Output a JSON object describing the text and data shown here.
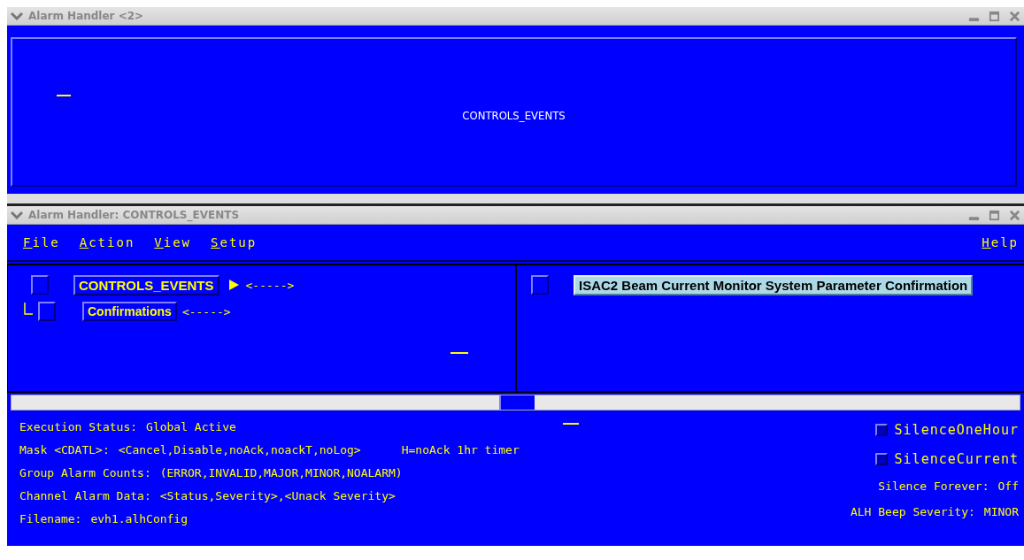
{
  "windows": [
    {
      "title": "Alarm Handler <2>",
      "kind": "icon",
      "label": "CONTROLS_EVENTS"
    },
    {
      "title": "Alarm Handler: CONTROLS_EVENTS",
      "kind": "main"
    }
  ],
  "menu": {
    "left": [
      "File",
      "Action",
      "View",
      "Setup"
    ],
    "right": [
      "Help"
    ]
  },
  "tree": [
    {
      "name": "CONTROLS_EVENTS",
      "arrow": true,
      "counts": "<----->",
      "children": [
        {
          "name": "Confirmations",
          "arrow": false,
          "counts": "<----->"
        }
      ]
    }
  ],
  "channels": [
    {
      "name": "ISAC2 Beam Current Monitor System Parameter Confirmation",
      "selected": true
    }
  ],
  "status": [
    {
      "label": "Execution Status:",
      "value": "Global Active"
    },
    {
      "label": "Mask <CDATL>:",
      "value": "<Cancel,Disable,noAck,noackT,noLog>",
      "note": "H=noAck 1hr timer"
    },
    {
      "label": "Group Alarm Counts:",
      "value": "(ERROR,INVALID,MAJOR,MINOR,NOALARM)"
    },
    {
      "label": "Channel Alarm Data:",
      "value": "<Status,Severity>,<Unack Severity>"
    },
    {
      "label": "Filename:",
      "value": "evh1.alhConfig"
    }
  ],
  "toggles": [
    {
      "label": "SilenceOneHour",
      "checked": false
    },
    {
      "label": "SilenceCurrent",
      "checked": false
    }
  ],
  "settings": [
    {
      "label": "Silence Forever:",
      "value": "Off"
    },
    {
      "label": "ALH Beep Severity:",
      "value": "MINOR"
    }
  ]
}
